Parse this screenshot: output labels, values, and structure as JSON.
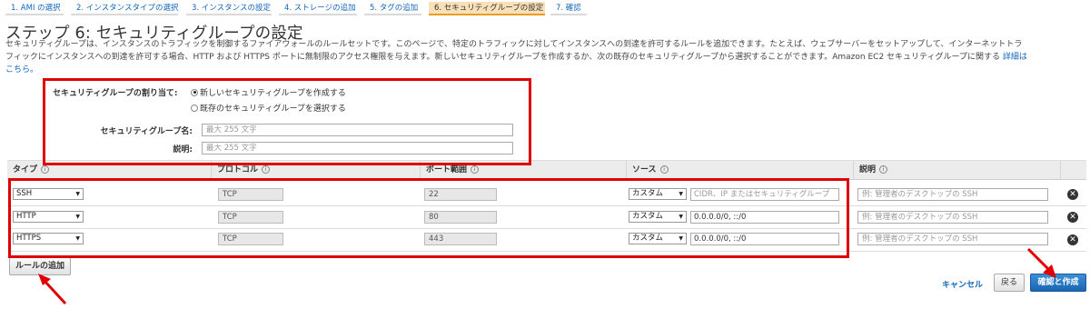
{
  "wizard": {
    "steps": [
      {
        "label": "1. AMI の選択"
      },
      {
        "label": "2. インスタンスタイプの選択"
      },
      {
        "label": "3. インスタンスの設定"
      },
      {
        "label": "4. ストレージの追加"
      },
      {
        "label": "5. タグの追加"
      },
      {
        "label": "6. セキュリティグループの設定",
        "active": true
      },
      {
        "label": "7. 確認"
      }
    ]
  },
  "page": {
    "title": "ステップ 6: セキュリティグループの設定",
    "description_line1": "セキュリティグループは、インスタンスのトラフィックを制御するファイアウォールのルールセットです。このページで、特定のトラフィックに対してインスタンスへの到達を許可するルールを追加できます。たとえば、ウェブサーバーをセットアップして、インターネットトラ",
    "description_line2": "フィックにインスタンスへの到達を許可する場合、HTTP および HTTPS ポートに無制限のアクセス権限を与えます。新しいセキュリティグループを作成するか、次の既存のセキュリティグループから選択することができます。Amazon EC2 セキュリティグループに関する",
    "description_link_part1": "詳細は",
    "description_link_part2": "こちら。"
  },
  "assign": {
    "label": "セキュリティグループの割り当て:",
    "option_new": "新しいセキュリティグループを作成する",
    "option_existing": "既存のセキュリティグループを選択する",
    "name_label": "セキュリティグループ名:",
    "name_placeholder": "最大 255 文字",
    "desc_label": "説明:",
    "desc_placeholder": "最大 255 文字"
  },
  "table": {
    "headers": [
      "タイプ",
      "プロトコル",
      "ポート範囲",
      "ソース",
      "説明"
    ],
    "rows": [
      {
        "type": "SSH",
        "protocol": "TCP",
        "port": "22",
        "source_mode": "カスタム",
        "source_value": "",
        "source_placeholder": "CIDR、IP またはセキュリティグループ",
        "desc_placeholder": "例: 管理者のデスクトップの SSH"
      },
      {
        "type": "HTTP",
        "protocol": "TCP",
        "port": "80",
        "source_mode": "カスタム",
        "source_value": "0.0.0.0/0, ::/0",
        "source_placeholder": "",
        "desc_placeholder": "例: 管理者のデスクトップの SSH"
      },
      {
        "type": "HTTPS",
        "protocol": "TCP",
        "port": "443",
        "source_mode": "カスタム",
        "source_value": "0.0.0.0/0, ::/0",
        "source_placeholder": "",
        "desc_placeholder": "例: 管理者のデスクトップの SSH"
      }
    ],
    "info_glyph": "i",
    "remove_glyph": "✕"
  },
  "buttons": {
    "add_rule": "ルールの追加",
    "cancel": "キャンセル",
    "back": "戻る",
    "review_launch": "確認と作成"
  },
  "colors": {
    "annotation_red": "#e00000",
    "primary_blue": "#1a66b0",
    "active_step_bg": "#f8e0b8"
  }
}
